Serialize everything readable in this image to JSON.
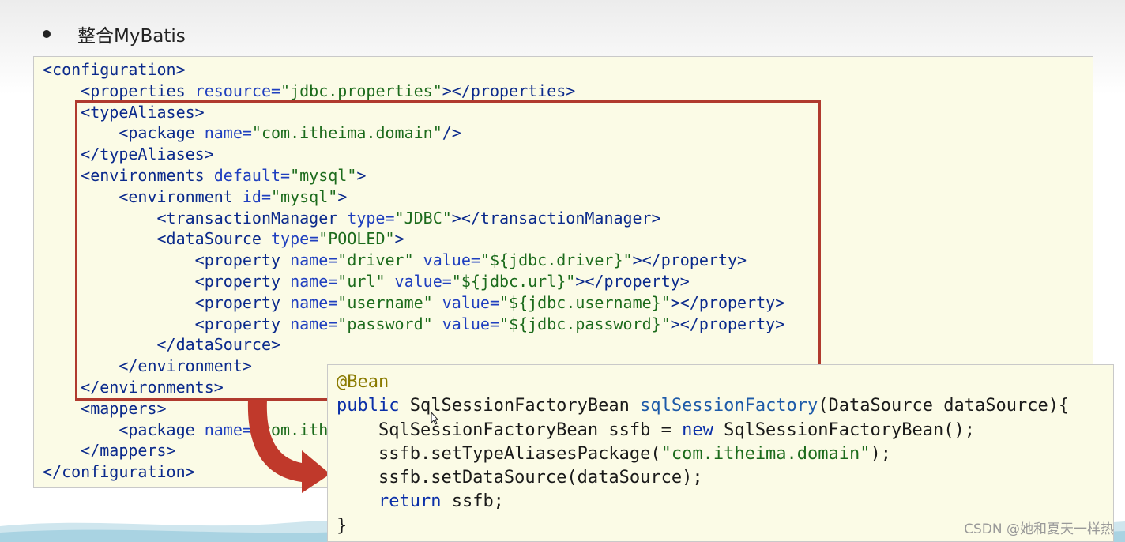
{
  "slide": {
    "title": "整合MyBatis"
  },
  "xml_lines": [
    [
      {
        "c": "t",
        "x": "<configuration>"
      }
    ],
    [
      {
        "c": "t",
        "x": "    <properties "
      },
      {
        "c": "a",
        "x": "resource="
      },
      {
        "c": "v",
        "x": "\"jdbc.properties\""
      },
      {
        "c": "t",
        "x": "></properties>"
      }
    ],
    [
      {
        "c": "t",
        "x": "    <typeAliases>"
      }
    ],
    [
      {
        "c": "t",
        "x": "        <package "
      },
      {
        "c": "a",
        "x": "name="
      },
      {
        "c": "v",
        "x": "\"com.itheima.domain\""
      },
      {
        "c": "t",
        "x": "/>"
      }
    ],
    [
      {
        "c": "t",
        "x": "    </typeAliases>"
      }
    ],
    [
      {
        "c": "t",
        "x": "    <environments "
      },
      {
        "c": "a",
        "x": "default="
      },
      {
        "c": "v",
        "x": "\"mysql\""
      },
      {
        "c": "t",
        "x": ">"
      }
    ],
    [
      {
        "c": "t",
        "x": "        <environment "
      },
      {
        "c": "a",
        "x": "id="
      },
      {
        "c": "v",
        "x": "\"mysql\""
      },
      {
        "c": "t",
        "x": ">"
      }
    ],
    [
      {
        "c": "t",
        "x": "            <transactionManager "
      },
      {
        "c": "a",
        "x": "type="
      },
      {
        "c": "v",
        "x": "\"JDBC\""
      },
      {
        "c": "t",
        "x": "></transactionManager>"
      }
    ],
    [
      {
        "c": "t",
        "x": "            <dataSource "
      },
      {
        "c": "a",
        "x": "type="
      },
      {
        "c": "v",
        "x": "\"POOLED\""
      },
      {
        "c": "t",
        "x": ">"
      }
    ],
    [
      {
        "c": "t",
        "x": "                <property "
      },
      {
        "c": "a",
        "x": "name="
      },
      {
        "c": "v",
        "x": "\"driver\" "
      },
      {
        "c": "a",
        "x": "value="
      },
      {
        "c": "v",
        "x": "\"${jdbc.driver}\""
      },
      {
        "c": "t",
        "x": "></property>"
      }
    ],
    [
      {
        "c": "t",
        "x": "                <property "
      },
      {
        "c": "a",
        "x": "name="
      },
      {
        "c": "v",
        "x": "\"url\" "
      },
      {
        "c": "a",
        "x": "value="
      },
      {
        "c": "v",
        "x": "\"${jdbc.url}\""
      },
      {
        "c": "t",
        "x": "></property>"
      }
    ],
    [
      {
        "c": "t",
        "x": "                <property "
      },
      {
        "c": "a",
        "x": "name="
      },
      {
        "c": "v",
        "x": "\"username\" "
      },
      {
        "c": "a",
        "x": "value="
      },
      {
        "c": "v",
        "x": "\"${jdbc.username}\""
      },
      {
        "c": "t",
        "x": "></property>"
      }
    ],
    [
      {
        "c": "t",
        "x": "                <property "
      },
      {
        "c": "a",
        "x": "name="
      },
      {
        "c": "v",
        "x": "\"password\" "
      },
      {
        "c": "a",
        "x": "value="
      },
      {
        "c": "v",
        "x": "\"${jdbc.password}\""
      },
      {
        "c": "t",
        "x": "></property>"
      }
    ],
    [
      {
        "c": "t",
        "x": "            </dataSource>"
      }
    ],
    [
      {
        "c": "t",
        "x": "        </environment>"
      }
    ],
    [
      {
        "c": "t",
        "x": "    </environments>"
      }
    ],
    [
      {
        "c": "t",
        "x": "    <mappers>"
      }
    ],
    [
      {
        "c": "t",
        "x": "        <package "
      },
      {
        "c": "a",
        "x": "name="
      },
      {
        "c": "v",
        "x": "\"com.ith"
      }
    ],
    [
      {
        "c": "t",
        "x": "    </mappers>"
      }
    ],
    [
      {
        "c": "t",
        "x": "</configuration>"
      }
    ]
  ],
  "java_lines": [
    [
      {
        "c": "ann",
        "x": "@Bean"
      }
    ],
    [
      {
        "c": "kw",
        "x": "public "
      },
      {
        "c": "p",
        "x": "SqlSessionFactoryBean "
      },
      {
        "c": "fn",
        "x": "sqlSessionFactory"
      },
      {
        "c": "p",
        "x": "(DataSource dataSource){"
      }
    ],
    [
      {
        "c": "p",
        "x": "    SqlSessionFactoryBean ssfb = "
      },
      {
        "c": "kw",
        "x": "new "
      },
      {
        "c": "p",
        "x": "SqlSessionFactoryBean();"
      }
    ],
    [
      {
        "c": "p",
        "x": "    ssfb.setTypeAliasesPackage("
      },
      {
        "c": "str",
        "x": "\"com.itheima.domain\""
      },
      {
        "c": "p",
        "x": ");"
      }
    ],
    [
      {
        "c": "p",
        "x": "    ssfb.setDataSource(dataSource);"
      }
    ],
    [
      {
        "c": "kw",
        "x": "    return "
      },
      {
        "c": "p",
        "x": "ssfb;"
      }
    ],
    [
      {
        "c": "p",
        "x": "}"
      }
    ]
  ],
  "watermark": "CSDN @她和夏天一样热",
  "colors": {
    "highlight_frame": "#b03a2e",
    "arrow": "#c0392b",
    "code_background": "#fbfbe6"
  },
  "icons": {
    "bullet": "bullet-dot-icon",
    "arrow": "curved-arrow-icon",
    "cursor": "mouse-cursor-icon"
  }
}
